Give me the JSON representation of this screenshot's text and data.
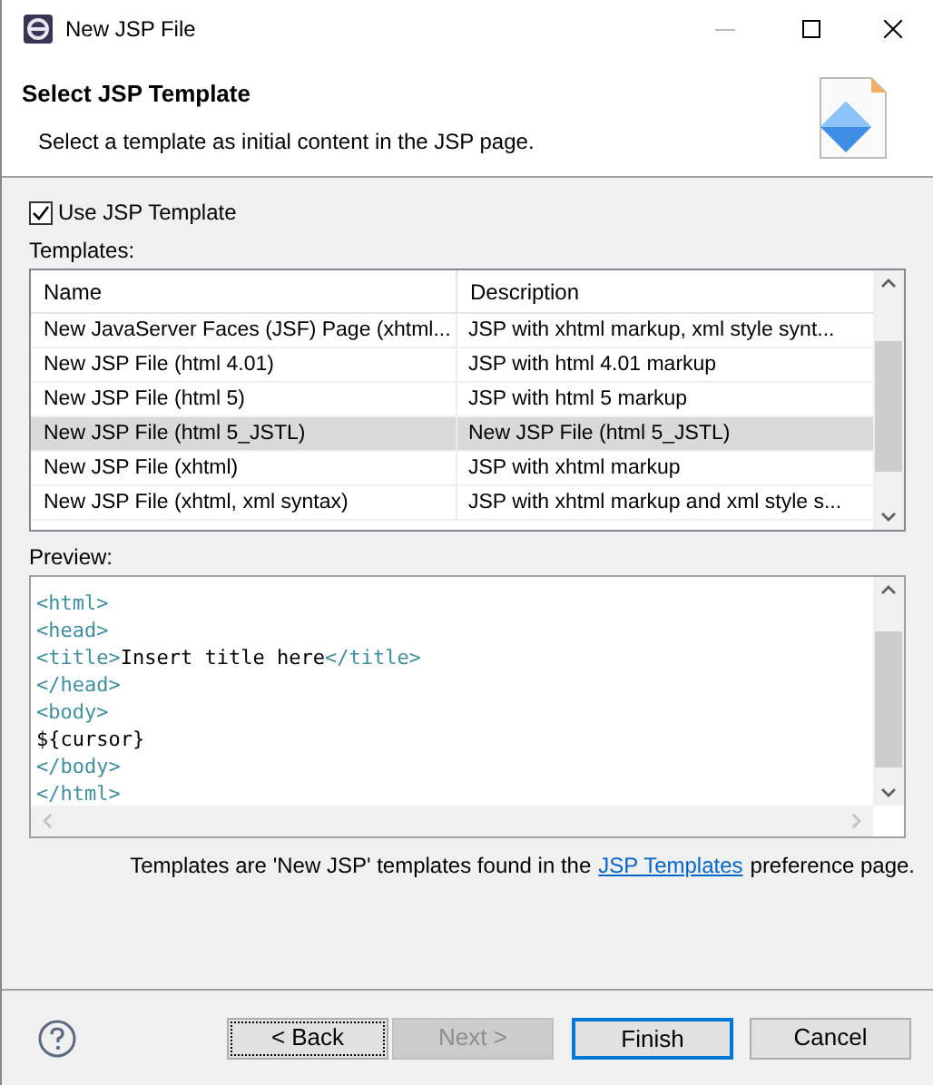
{
  "window": {
    "title": "New JSP File"
  },
  "header": {
    "title": "Select JSP Template",
    "description": "Select a template as initial content in the JSP page."
  },
  "use_template": {
    "label": "Use JSP Template",
    "checked": true
  },
  "templates": {
    "label": "Templates:",
    "columns": [
      "Name",
      "Description"
    ],
    "rows": [
      {
        "name": "New JavaServer Faces (JSF) Page (xhtml...",
        "description": "JSP with xhtml markup, xml style synt...",
        "selected": false
      },
      {
        "name": "New JSP File (html 4.01)",
        "description": "JSP with html 4.01 markup",
        "selected": false
      },
      {
        "name": "New JSP File (html 5)",
        "description": "JSP with html 5 markup",
        "selected": false
      },
      {
        "name": "New JSP File (html 5_JSTL)",
        "description": "New JSP File (html 5_JSTL)",
        "selected": true
      },
      {
        "name": "New JSP File (xhtml)",
        "description": "JSP with xhtml markup",
        "selected": false
      },
      {
        "name": "New JSP File (xhtml, xml syntax)",
        "description": "JSP with xhtml markup and xml style s...",
        "selected": false
      }
    ]
  },
  "preview": {
    "label": "Preview:",
    "lines": [
      [
        {
          "kind": "tag",
          "text": "<html>"
        }
      ],
      [
        {
          "kind": "tag",
          "text": "<head>"
        }
      ],
      [
        {
          "kind": "tag",
          "text": "<title>"
        },
        {
          "kind": "text",
          "text": "Insert title here"
        },
        {
          "kind": "tag",
          "text": "</title>"
        }
      ],
      [
        {
          "kind": "tag",
          "text": "</head>"
        }
      ],
      [
        {
          "kind": "tag",
          "text": "<body>"
        }
      ],
      [
        {
          "kind": "text",
          "text": "${cursor}"
        }
      ],
      [
        {
          "kind": "tag",
          "text": "</body>"
        }
      ],
      [
        {
          "kind": "tag",
          "text": "</html>"
        }
      ]
    ]
  },
  "note": {
    "before": "Templates are 'New JSP' templates found in the",
    "link": "JSP Templates",
    "after": "preference page."
  },
  "buttons": [
    {
      "label": "< Back",
      "kind": "focused",
      "disabled": false
    },
    {
      "label": "Next >",
      "kind": "normal",
      "disabled": true
    },
    {
      "label": "Finish",
      "kind": "default",
      "disabled": false
    },
    {
      "label": "Cancel",
      "kind": "normal",
      "disabled": false
    }
  ]
}
